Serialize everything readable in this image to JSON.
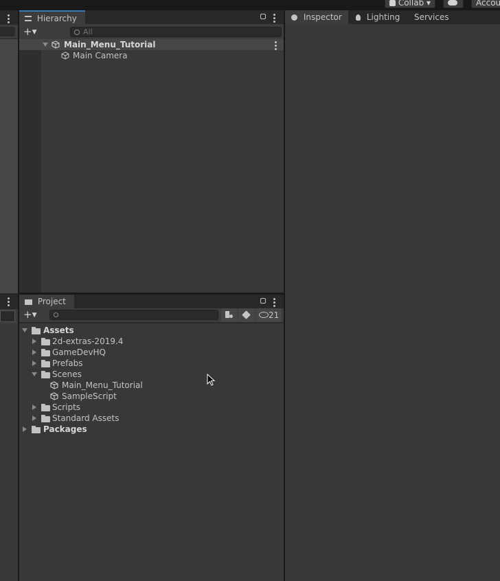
{
  "topbar": {
    "collab_label": "Collab",
    "account_label": "Accou"
  },
  "hierarchy": {
    "tab_label": "Hierarchy",
    "search_placeholder": "All",
    "scene_name": "Main_Menu_Tutorial",
    "objects": [
      "Main Camera"
    ]
  },
  "inspector_tabs": {
    "inspector": "Inspector",
    "lighting": "Lighting",
    "services": "Services"
  },
  "project": {
    "tab_label": "Project",
    "hidden_count": "21",
    "tree": {
      "assets": "Assets",
      "folders": [
        "2d-extras-2019.4",
        "GameDevHQ",
        "Prefabs",
        "Scenes"
      ],
      "scene_files": [
        "Main_Menu_Tutorial",
        "SampleScript"
      ],
      "folders_after": [
        "Scripts",
        "Standard Assets"
      ],
      "packages": "Packages"
    }
  },
  "icons": [
    "lock-icon",
    "kebab-menu-icon",
    "add-icon",
    "search-icon",
    "unity-scene-icon",
    "cube-icon",
    "folder-icon",
    "lightbulb-icon",
    "info-icon",
    "eye-hidden-icon",
    "label-icon",
    "filter-type-icon",
    "cloud-icon",
    "mouse-cursor-icon"
  ]
}
